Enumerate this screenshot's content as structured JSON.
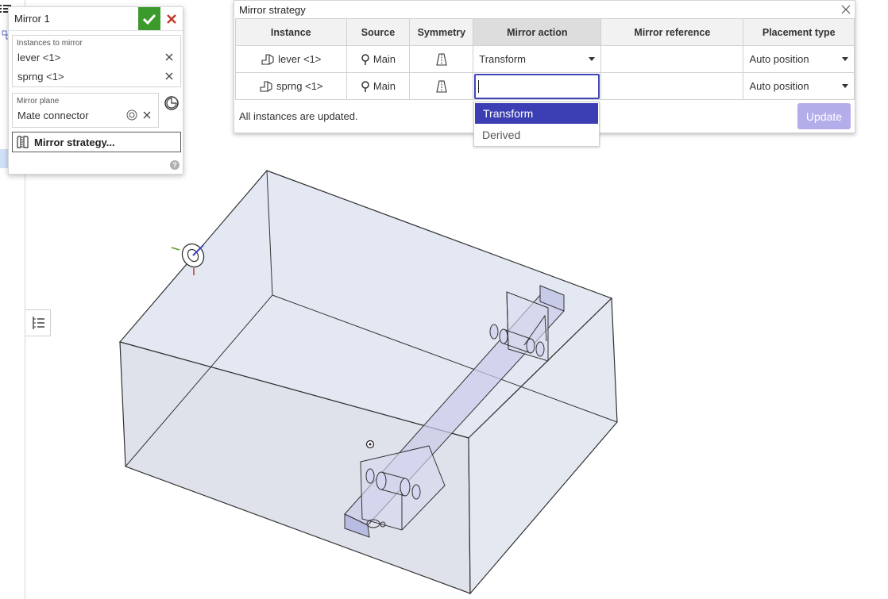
{
  "feature_dialog": {
    "title": "Mirror 1",
    "instances_label": "Instances to mirror",
    "instances": [
      "lever <1>",
      "sprng <1>"
    ],
    "mirror_plane_label": "Mirror plane",
    "mirror_plane_value": "Mate connector",
    "strategy_button": "Mirror strategy..."
  },
  "strategy_dialog": {
    "title": "Mirror strategy",
    "columns": [
      "Instance",
      "Source",
      "Symmetry",
      "Mirror action",
      "Mirror reference",
      "Placement type"
    ],
    "rows": [
      {
        "instance": "lever <1>",
        "source": "Main",
        "mirror_action": "Transform",
        "mirror_reference": "",
        "placement": "Auto position"
      },
      {
        "instance": "sprng <1>",
        "source": "Main",
        "mirror_action": "",
        "mirror_reference": "",
        "placement": "Auto position"
      }
    ],
    "status": "All instances are updated.",
    "update_button": "Update"
  },
  "dropdown": {
    "options": [
      "Transform",
      "Derived"
    ],
    "selected": "Transform"
  },
  "colors": {
    "accent": "#3c3fb3",
    "confirm": "#3c9a2c",
    "cancel": "#c0392b",
    "update_disabled": "#b3aeea"
  }
}
